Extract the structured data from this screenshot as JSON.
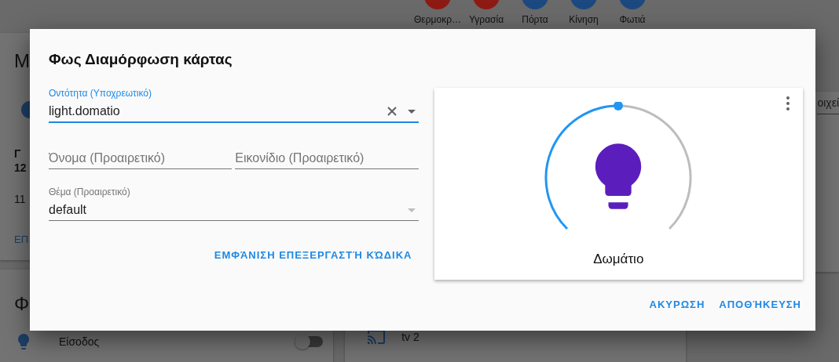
{
  "background": {
    "badges": [
      {
        "label": "Θερμοκρ…",
        "color": "#8e1b13"
      },
      {
        "label": "Υγρασία",
        "color": "#8e1b13"
      },
      {
        "label": "Πόρτα",
        "color": "#1c4a80"
      },
      {
        "label": "Κίνηση",
        "color": "#1c4a80"
      },
      {
        "label": "Φωτιά",
        "color": "#1c4a80"
      }
    ],
    "weather_card": {
      "title": "M",
      "lines": [
        {
          "text": "Γ",
          "kind": "bold"
        },
        {
          "text": "12",
          "kind": "bold"
        },
        {
          "text": "11",
          "kind": "plain"
        }
      ],
      "action": "ΕΠ"
    },
    "lights_card": {
      "title": "Φ",
      "rows": [
        {
          "name": "Είσοδος",
          "on": false
        }
      ]
    },
    "media_card": {
      "rows": [
        {
          "name": "tv 2"
        }
      ]
    },
    "side_field": {
      "label": "οιχεί"
    }
  },
  "dialog": {
    "title": "Φως Διαμόρφωση κάρτας",
    "entity_field": {
      "label": "Οντότητα (Υποχρεωτικό)",
      "value": "light.domatio"
    },
    "name_field": {
      "placeholder": "Όνομα (Προαιρετικό)"
    },
    "icon_field": {
      "placeholder": "Εικονίδιο (Προαιρετικό)"
    },
    "theme_field": {
      "label": "Θέμα (Προαιρετικό)",
      "value": "default"
    },
    "code_editor_button": "ΕΜΦΆΝΙΣΗ ΕΠΕΞΕΡΓΑΣΤΉ ΚΏΔΙΚΑ",
    "preview": {
      "name": "Δωμάτιο",
      "level": 0.5
    },
    "buttons": [
      "ΑΚΥΡΩΣΗ",
      "ΑΠΟΘΉΚΕΥΣΗ"
    ]
  }
}
